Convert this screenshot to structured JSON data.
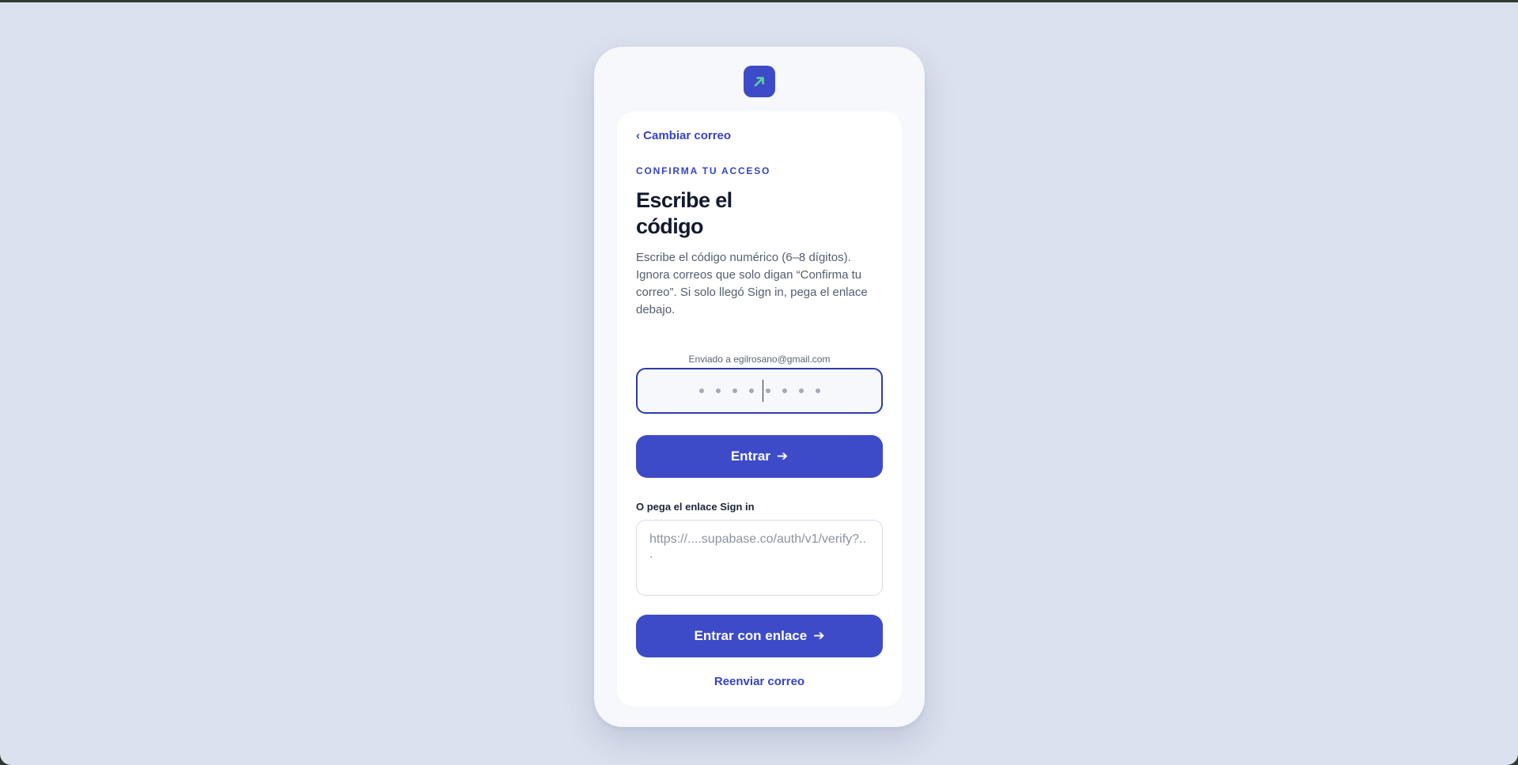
{
  "brand": {
    "logo_icon": "arrow-up-right-icon",
    "logo_bg": "#3d4bc8",
    "logo_arrow": "#5fd0a3"
  },
  "colors": {
    "accent": "#3d4bc8",
    "background": "#dbe1ee"
  },
  "nav": {
    "back_label": "‹ Cambiar correo"
  },
  "header": {
    "eyebrow": "CONFIRMA TU ACCESO",
    "title": "Escribe el código"
  },
  "description": "Escribe el código numérico (6–8 dígitos). Ignora correos que solo digan “Confirma tu correo”. Si solo llegó Sign in, pega el enlace debajo.",
  "code": {
    "sent_to": "Enviado a egilrosano@gmail.com",
    "value": "",
    "placeholder_dots": 8
  },
  "enter_button": {
    "label": "Entrar",
    "icon": "arrow-right-icon"
  },
  "link_section": {
    "label": "O pega el enlace Sign in",
    "placeholder": "https://....supabase.co/auth/v1/verify?...",
    "value": ""
  },
  "enter_link_button": {
    "label": "Entrar con enlace",
    "icon": "arrow-right-icon"
  },
  "resend_label": "Reenviar correo"
}
